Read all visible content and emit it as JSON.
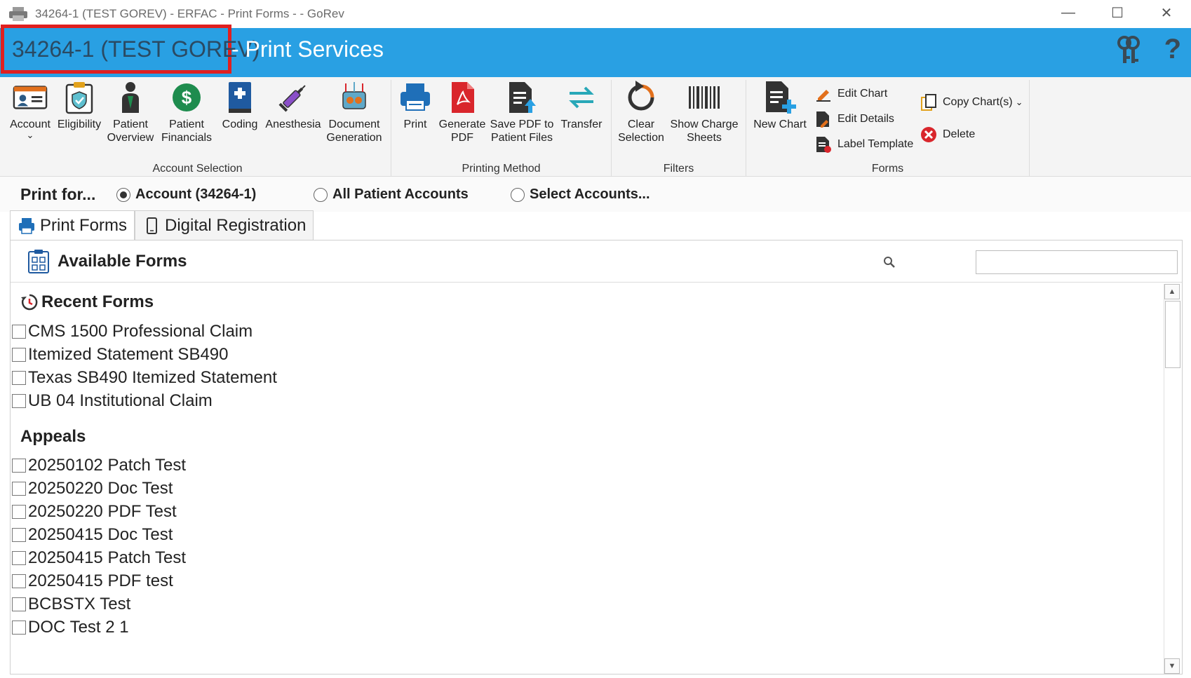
{
  "window": {
    "title": "34264-1 (TEST GOREV)  - ERFAC - Print Forms -  - GoRev",
    "controls": [
      "minimize",
      "maximize",
      "close"
    ]
  },
  "header": {
    "account": "34264-1 (TEST GOREV)",
    "service": " - Print Services",
    "icons": [
      "keys-icon",
      "help-icon"
    ]
  },
  "ribbon": {
    "account_selection": {
      "label": "Account Selection",
      "buttons": [
        {
          "name": "account",
          "label": "Account"
        },
        {
          "name": "eligibility",
          "label": "Eligibility"
        },
        {
          "name": "patient-overview",
          "label": "Patient\nOverview"
        },
        {
          "name": "patient-financials",
          "label": "Patient\nFinancials"
        },
        {
          "name": "coding",
          "label": "Coding"
        },
        {
          "name": "anesthesia",
          "label": "Anesthesia"
        },
        {
          "name": "document-generation",
          "label": "Document\nGeneration"
        }
      ]
    },
    "printing_method": {
      "label": "Printing Method",
      "buttons": [
        {
          "name": "print",
          "label": "Print"
        },
        {
          "name": "generate-pdf",
          "label": "Generate\nPDF"
        },
        {
          "name": "save-pdf",
          "label": "Save PDF to\nPatient Files"
        },
        {
          "name": "transfer",
          "label": "Transfer"
        }
      ]
    },
    "filters": {
      "label": "Filters",
      "buttons": [
        {
          "name": "clear-selection",
          "label": "Clear\nSelection"
        },
        {
          "name": "show-charge-sheets",
          "label": "Show Charge\nSheets"
        }
      ]
    },
    "forms": {
      "label": "Forms",
      "buttons": [
        {
          "name": "new-chart",
          "label": "New Chart"
        },
        {
          "name": "edit-chart",
          "label": "Edit Chart"
        },
        {
          "name": "edit-details",
          "label": "Edit Details"
        },
        {
          "name": "label-template",
          "label": "Label Template"
        },
        {
          "name": "copy-charts",
          "label": "Copy Chart(s)"
        },
        {
          "name": "delete",
          "label": "Delete"
        }
      ]
    }
  },
  "print_for": {
    "label": "Print for...",
    "options": [
      {
        "label": "Account (34264-1)",
        "selected": true
      },
      {
        "label": "All Patient Accounts",
        "selected": false
      },
      {
        "label": "Select Accounts...",
        "selected": false
      }
    ]
  },
  "tabs": [
    {
      "label": "Print Forms",
      "active": true
    },
    {
      "label": "Digital Registration",
      "active": false
    }
  ],
  "panel": {
    "title": "Available Forms",
    "search_value": "",
    "sections": [
      {
        "title": "Recent Forms",
        "items": [
          "CMS 1500 Professional Claim",
          "Itemized Statement SB490",
          "Texas SB490 Itemized Statement",
          "UB 04 Institutional Claim"
        ]
      },
      {
        "title": "Appeals",
        "items": [
          "20250102 Patch Test",
          "20250220 Doc Test",
          "20250220 PDF Test",
          "20250415 Doc Test",
          "20250415 Patch Test",
          "20250415 PDF test",
          "BCBSTX Test",
          "DOC Test 2 1"
        ]
      }
    ]
  },
  "colors": {
    "header_blue": "#29a0e3",
    "highlight_red": "#e02020",
    "green": "#1e8c4e",
    "red": "#d9262c"
  }
}
